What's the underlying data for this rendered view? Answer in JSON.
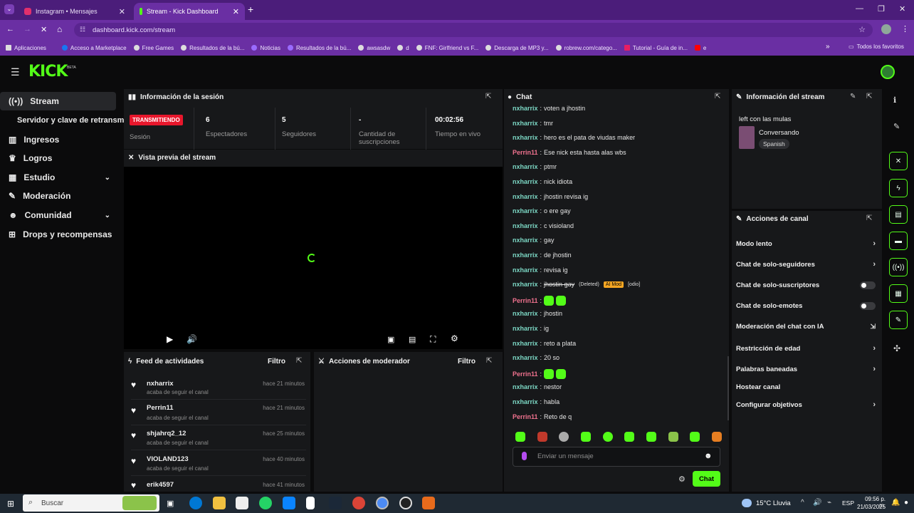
{
  "browser": {
    "tabs": [
      {
        "label": "Instagram • Mensajes",
        "active": false
      },
      {
        "label": "Stream - Kick Dashboard",
        "active": true
      }
    ],
    "new_tab": "+",
    "url": "dashboard.kick.com/stream",
    "bookmarks": [
      "Aplicaciones",
      "Acceso a Marketplace",
      "Free Games",
      "Resultados de la bú...",
      "Noticias",
      "Resultados de la bú...",
      "awsasdw",
      "d",
      "FNF: Girlfriend vs F...",
      "Descarga de MP3 y...",
      "robrew.com/catego...",
      "Tutorial - Guía de in...",
      "e"
    ],
    "bookmarks_more": "»",
    "all_favorites": "Todos los favoritos"
  },
  "app": {
    "logo": "KICK",
    "logo_beta": "BETA"
  },
  "sidebar": {
    "items": [
      {
        "label": "Stream",
        "icon": "broadcast-icon",
        "active": true
      },
      {
        "label": "Servidor y clave de retransm",
        "sub": true
      },
      {
        "label": "Ingresos",
        "icon": "chart-icon"
      },
      {
        "label": "Logros",
        "icon": "trophy-icon"
      },
      {
        "label": "Estudio",
        "icon": "grid-icon",
        "chevron": true
      },
      {
        "label": "Moderación",
        "icon": "wrench-icon"
      },
      {
        "label": "Comunidad",
        "icon": "users-icon",
        "chevron": true
      },
      {
        "label": "Drops y recompensas",
        "icon": "gift-icon"
      }
    ]
  },
  "session": {
    "title": "Información de la sesión",
    "live_badge": "TRANSMITIENDO",
    "live_label": "Sesión",
    "stats": [
      {
        "value": "6",
        "label": "Espectadores"
      },
      {
        "value": "5",
        "label": "Seguidores"
      },
      {
        "value": "-",
        "label": "Cantidad de suscripciones"
      },
      {
        "value": "00:02:56",
        "label": "Tiempo en vivo"
      }
    ]
  },
  "preview": {
    "title": "Vista previa del stream"
  },
  "feed": {
    "title": "Feed de actividades",
    "filter": "Filtro",
    "items": [
      {
        "name": "nxharrix",
        "sub": "acaba de seguir el canal",
        "time": "hace 21 minutos"
      },
      {
        "name": "Perrin11",
        "sub": "acaba de seguir el canal",
        "time": "hace 21 minutos"
      },
      {
        "name": "shjahrq2_12",
        "sub": "acaba de seguir el canal",
        "time": "hace 25 minutos"
      },
      {
        "name": "VIOLAND123",
        "sub": "acaba de seguir el canal",
        "time": "hace 40 minutos"
      },
      {
        "name": "erik4597",
        "sub": "",
        "time": "hace 41 minutos"
      }
    ]
  },
  "modactions": {
    "title": "Acciones de moderador",
    "filter": "Filtro"
  },
  "chat": {
    "title": "Chat",
    "messages": [
      {
        "user": "nxharrix",
        "text": "voten a jhostin",
        "color": "#7bd6c3"
      },
      {
        "user": "nxharrix",
        "text": "tmr",
        "color": "#7bd6c3"
      },
      {
        "user": "nxharrix",
        "text": "hero es el pata de viudas maker",
        "color": "#7bd6c3"
      },
      {
        "user": "Perrin11",
        "text": "Ese nick esta hasta alas wbs",
        "color": "#f0728f"
      },
      {
        "user": "nxharrix",
        "text": "ptmr",
        "color": "#7bd6c3"
      },
      {
        "user": "nxharrix",
        "text": "nick idiota",
        "color": "#7bd6c3"
      },
      {
        "user": "nxharrix",
        "text": "jhostin revisa ig",
        "color": "#7bd6c3"
      },
      {
        "user": "nxharrix",
        "text": "o ere gay",
        "color": "#7bd6c3"
      },
      {
        "user": "nxharrix",
        "text": "c visioland",
        "color": "#7bd6c3"
      },
      {
        "user": "nxharrix",
        "text": "gay",
        "color": "#7bd6c3"
      },
      {
        "user": "nxharrix",
        "text": "de jhostin",
        "color": "#7bd6c3"
      },
      {
        "user": "nxharrix",
        "text": "revisa ig",
        "color": "#7bd6c3"
      },
      {
        "user": "nxharrix",
        "text": "jhostin gay",
        "color": "#7bd6c3",
        "deleted": "(Deleted)",
        "mod": "AI Mod",
        "reason": "[odio]"
      },
      {
        "user": "Perrin11",
        "text": "",
        "color": "#f0728f",
        "emotes": 2
      },
      {
        "user": "nxharrix",
        "text": "jhostin",
        "color": "#7bd6c3"
      },
      {
        "user": "nxharrix",
        "text": "ig",
        "color": "#7bd6c3"
      },
      {
        "user": "nxharrix",
        "text": "reto a plata",
        "color": "#7bd6c3"
      },
      {
        "user": "nxharrix",
        "text": "20 so",
        "color": "#7bd6c3"
      },
      {
        "user": "Perrin11",
        "text": "",
        "color": "#f0728f",
        "emotes": 2
      },
      {
        "user": "nxharrix",
        "text": "nestor",
        "color": "#7bd6c3"
      },
      {
        "user": "nxharrix",
        "text": "habla",
        "color": "#7bd6c3"
      },
      {
        "user": "Perrin11",
        "text": "Reto de q",
        "color": "#f0728f"
      }
    ],
    "input_placeholder": "Enviar un mensaje",
    "send_label": "Chat"
  },
  "stream_info": {
    "title": "Información del stream",
    "stream_title": "left con las mulas",
    "category": "Conversando",
    "language": "Spanish"
  },
  "channel_actions": {
    "title": "Acciones de canal",
    "items": [
      {
        "label": "Modo lento",
        "control": "chevron"
      },
      {
        "label": "Chat de solo-seguidores",
        "control": "chevron"
      },
      {
        "label": "Chat de solo-suscriptores",
        "control": "toggle"
      },
      {
        "label": "Chat de solo-emotes",
        "control": "toggle"
      },
      {
        "label": "Moderación del chat con IA",
        "control": "link"
      },
      {
        "label": "Restricción de edad",
        "control": "chevron"
      },
      {
        "label": "Palabras baneadas",
        "control": "chevron"
      },
      {
        "label": "Hostear canal",
        "control": "none"
      },
      {
        "label": "Configurar objetivos",
        "control": "chevron"
      }
    ]
  },
  "taskbar": {
    "search": "Buscar",
    "weather": "15°C Lluvia",
    "lang": "ESP",
    "time": "09:56 p. m.",
    "date": "21/03/2025"
  },
  "colors": {
    "accent": "#53fc18",
    "live": "#e8172c",
    "chrome": "#6a2fa3"
  }
}
